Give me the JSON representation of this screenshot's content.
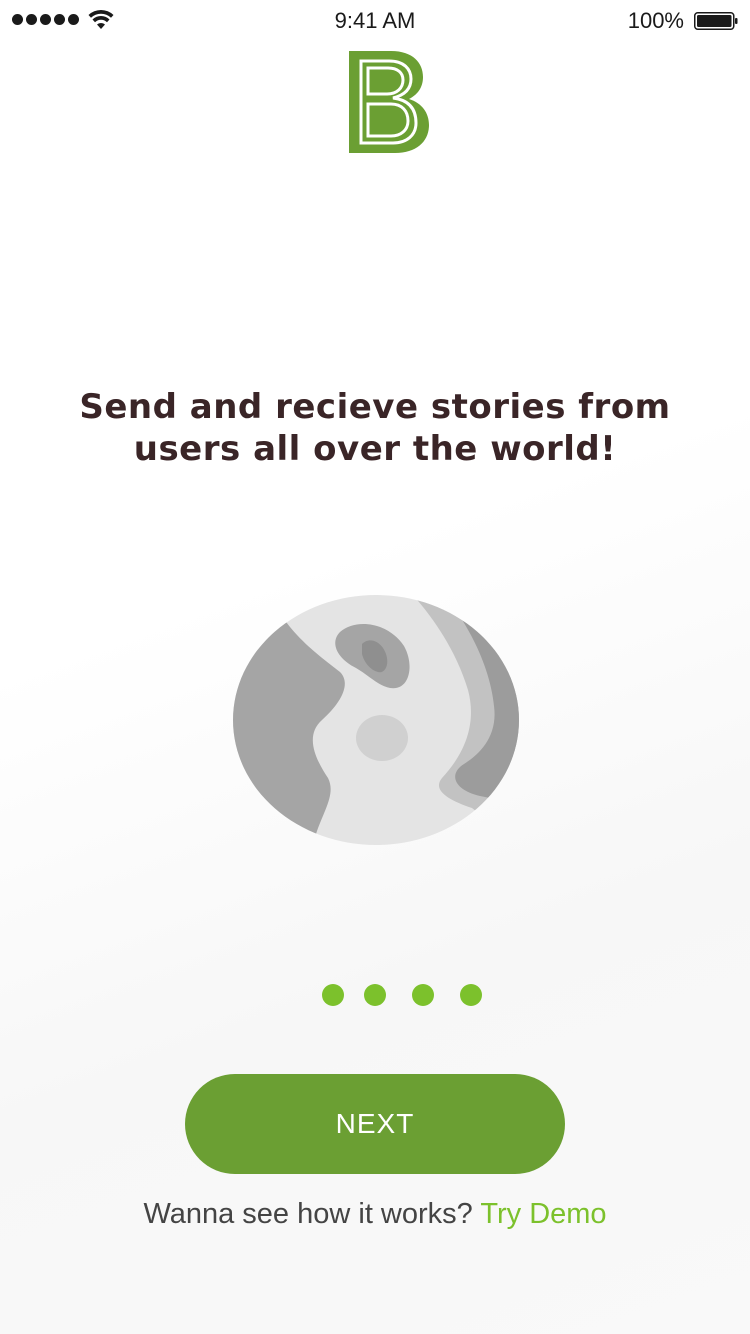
{
  "status_bar": {
    "time": "9:41 AM",
    "battery_percent": "100%",
    "signal_bars": 5,
    "icons": [
      "signal-icon",
      "wifi-icon",
      "battery-icon"
    ]
  },
  "logo": {
    "letter": "B",
    "color": "#6b9f33"
  },
  "onboarding": {
    "headline_line1": "Send and recieve stories from",
    "headline_line2": "users all over the world!",
    "illustration": "globe-icon",
    "page_count": 4
  },
  "actions": {
    "next_label": "NEXT",
    "demo_prompt": "Wanna see how it works?",
    "demo_link": "Try Demo"
  },
  "colors": {
    "brand_green": "#6b9f33",
    "accent_green": "#7cc12c",
    "headline": "#3a2527"
  }
}
